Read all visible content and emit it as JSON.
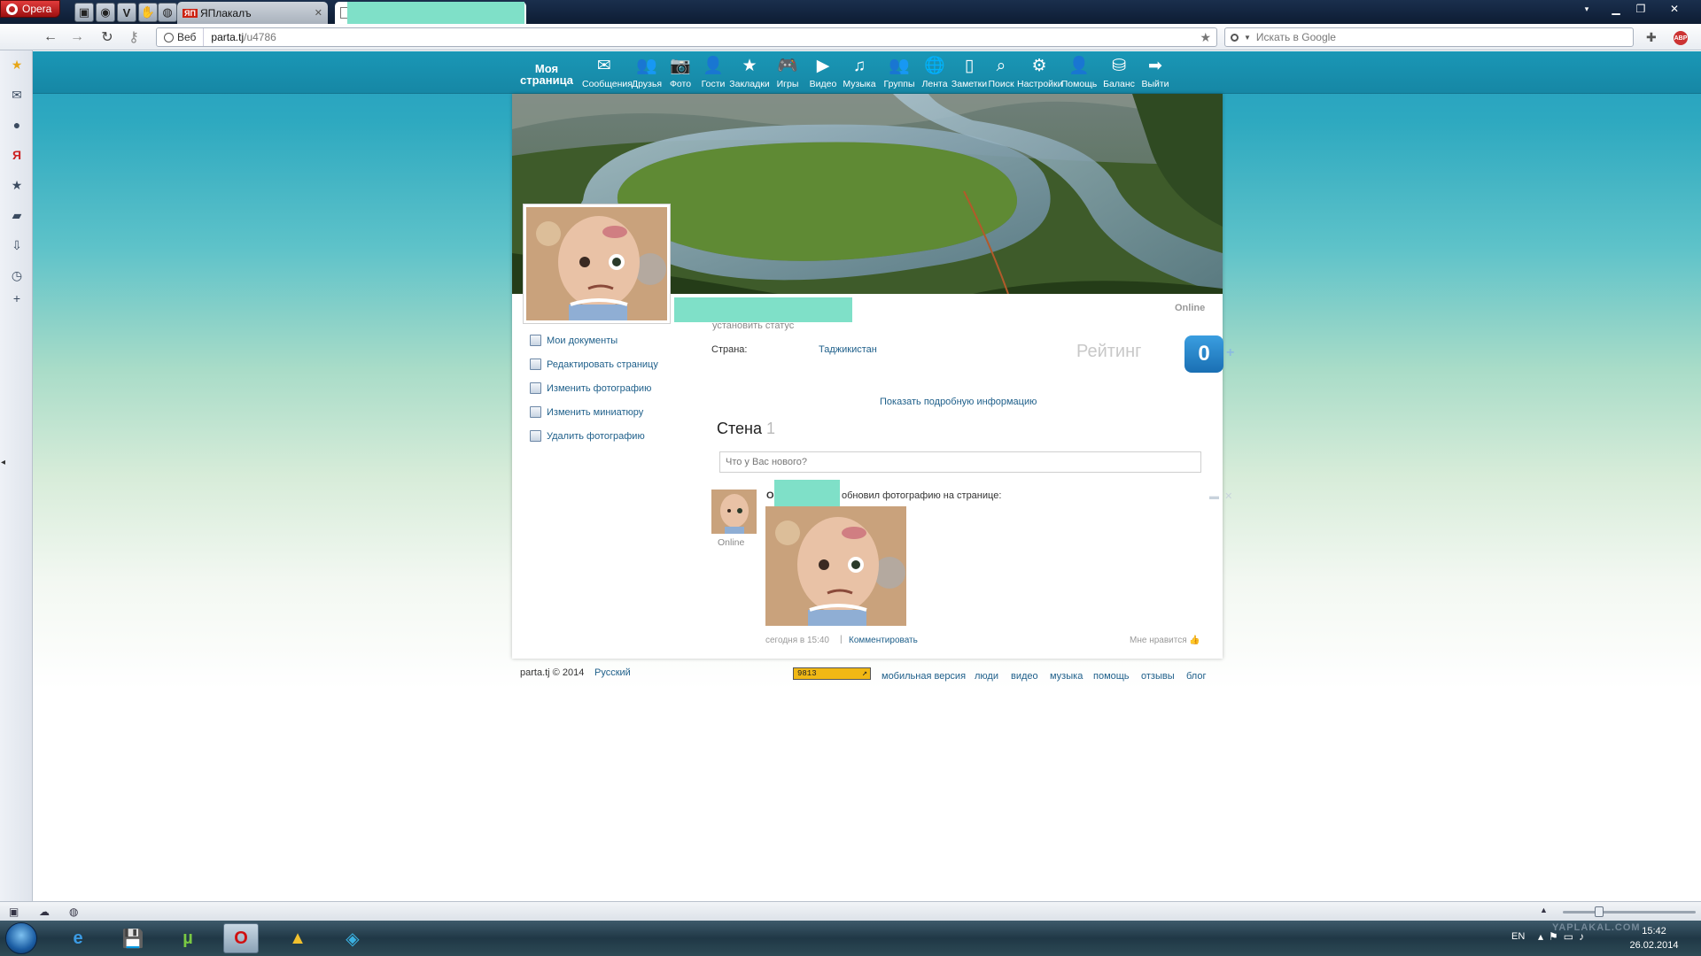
{
  "browser": {
    "menu_label": "Opera",
    "tabs": [
      {
        "label": "ЯПлакалъ",
        "favicon": "ЯП"
      },
      {
        "label": ""
      }
    ],
    "address": {
      "badge": "Веб",
      "url_host": "parta.tj",
      "url_path": "/u4786"
    },
    "search_placeholder": "Искать в Google",
    "adblock_label": "ABP"
  },
  "site": {
    "nav": {
      "my_page": "Моя страница",
      "items": [
        {
          "label": "Сообщения",
          "icon": "envelope-icon"
        },
        {
          "label": "Друзья",
          "icon": "friends-icon"
        },
        {
          "label": "Фото",
          "icon": "camera-icon"
        },
        {
          "label": "Гости",
          "icon": "guest-icon"
        },
        {
          "label": "Закладки",
          "icon": "star-icon"
        },
        {
          "label": "Игры",
          "icon": "gamepad-icon"
        },
        {
          "label": "Видео",
          "icon": "play-icon"
        },
        {
          "label": "Музыка",
          "icon": "music-icon"
        },
        {
          "label": "Группы",
          "icon": "group-icon"
        },
        {
          "label": "Лента",
          "icon": "globe-icon"
        },
        {
          "label": "Заметки",
          "icon": "note-icon"
        },
        {
          "label": "Поиск",
          "icon": "search-icon"
        },
        {
          "label": "Настройки",
          "icon": "gear-icon"
        },
        {
          "label": "Помощь",
          "icon": "help-icon"
        },
        {
          "label": "Баланс",
          "icon": "coins-icon"
        },
        {
          "label": "Выйти",
          "icon": "exit-arrow-icon"
        }
      ]
    },
    "profile": {
      "set_status": "установить статус",
      "online": "Online",
      "actions": [
        "Мои документы",
        "Редактировать страницу",
        "Изменить фотографию",
        "Изменить миниатюру",
        "Удалить фотографию"
      ],
      "country_label": "Страна:",
      "country_value": "Таджикистан",
      "rating_label": "Рейтинг",
      "rating_value": "0",
      "rating_plus": "+",
      "more_info": "Показать подробную информацию"
    },
    "wall": {
      "title": "Стена",
      "count": "1",
      "input_placeholder": "Что у Вас нового?",
      "post": {
        "author_initial": "О",
        "action": "обновил фотографию на странице:",
        "online": "Online",
        "time": "сегодня в 15:40",
        "separator": "|",
        "comment": "Комментировать",
        "like": "Мне нравится"
      }
    },
    "footer": {
      "copyright": "parta.tj © 2014",
      "language": "Русский",
      "counter": "9813",
      "links": [
        "мобильная версия",
        "люди",
        "видео",
        "музыка",
        "помощь",
        "отзывы",
        "блог"
      ]
    }
  },
  "taskbar": {
    "lang": "EN",
    "time": "15:42",
    "date": "26.02.2014",
    "watermark": "YAPLAKAL.COM"
  },
  "colors": {
    "nav_bg": "#1a97b6",
    "link": "#1e5f8a",
    "rating_badge": "#1a6fb3",
    "redaction": "#7fe0c8"
  }
}
